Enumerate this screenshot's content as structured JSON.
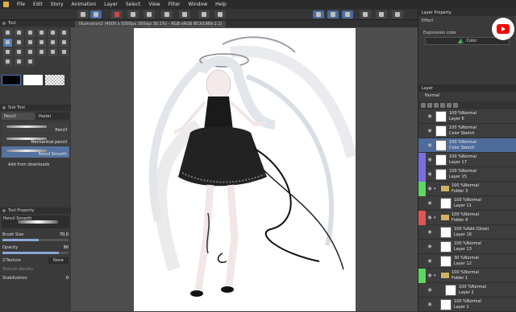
{
  "menu": {
    "items": [
      "File",
      "Edit",
      "Story",
      "Animation",
      "Layer",
      "Select",
      "View",
      "Filter",
      "Window",
      "Help"
    ]
  },
  "toolbar": {
    "buttons": [
      "menu-icon",
      "undo-icon",
      "redo-icon",
      "save-icon",
      "copy-icon",
      "paste-icon",
      "transform-icon",
      "select-all-icon",
      "deselect-icon",
      "pen-stabilize-icon",
      "snap-icon",
      "snap-ruler-icon",
      "ruler-icon",
      "refresh-icon",
      "grid-icon"
    ]
  },
  "tool_panel": {
    "title": "Tool"
  },
  "subtool_panel": {
    "title": "Sub Tool",
    "tabs": [
      "Pencil",
      "Pastel"
    ],
    "brushes": [
      {
        "name": "Pencil"
      },
      {
        "name": "Mechanical pencil"
      },
      {
        "name": "Pencil Smooth"
      }
    ],
    "add_from_downloads": "Add from downloads"
  },
  "tool_property": {
    "title": "Tool Property",
    "preview_label": "Pencil Smooth",
    "brush_size_label": "Brush Size",
    "brush_size_value": "70.0",
    "opacity_label": "Opacity",
    "opacity_value": "90",
    "texture_label": "2-Texture",
    "texture_value": "None",
    "blend_label": "Texture density",
    "stabilization_label": "Stabilization",
    "stabilization_value": "0"
  },
  "document": {
    "tab_title": "Illustration2 (4000 x 5000px 350dpi 30.1%) - RGB sRGB IEC61966-2.1)"
  },
  "layer_property": {
    "title": "Layer Property",
    "effect_label": "Effect",
    "expression_label": "Expression color",
    "expression_value": "Color"
  },
  "layer_panel": {
    "title": "Layer",
    "blend_mode": "Normal",
    "layers": [
      {
        "line1": "100 %Normal",
        "line2": "Layer 6",
        "kind": "layer",
        "indent": 0,
        "color": ""
      },
      {
        "line1": "100 %Normal",
        "line2": "Color Sketch",
        "kind": "layer",
        "indent": 0,
        "color": ""
      },
      {
        "line1": "100 %Normal",
        "line2": "Color Sketch",
        "kind": "layer",
        "indent": 0,
        "color": "",
        "selected": true
      },
      {
        "line1": "100 %Normal",
        "line2": "Layer 17",
        "kind": "layer",
        "indent": 0,
        "color": "#7b6fe0"
      },
      {
        "line1": "100 %Normal",
        "line2": "Layer 15",
        "kind": "layer",
        "indent": 0,
        "color": "#7b6fe0"
      },
      {
        "line1": "100 %Normal",
        "line2": "Folder 3",
        "kind": "folder",
        "indent": 0,
        "color": "#5fd65f"
      },
      {
        "line1": "100 %Normal",
        "line2": "Layer 11",
        "kind": "layer",
        "indent": 1,
        "color": ""
      },
      {
        "line1": "100 %Normal",
        "line2": "Folder 4",
        "kind": "folder",
        "indent": 0,
        "color": "#e05555"
      },
      {
        "line1": "100 %Add (Glow)",
        "line2": "Layer 16",
        "kind": "layer",
        "indent": 1,
        "color": ""
      },
      {
        "line1": "100 %Normal",
        "line2": "Layer 13",
        "kind": "layer",
        "indent": 1,
        "color": ""
      },
      {
        "line1": "30 %Normal",
        "line2": "Layer 12",
        "kind": "layer",
        "indent": 1,
        "color": ""
      },
      {
        "line1": "100 %Normal",
        "line2": "Folder 1",
        "kind": "folder",
        "indent": 0,
        "color": "#5fd65f"
      },
      {
        "line1": "100 %Normal",
        "line2": "Layer 2",
        "kind": "layer",
        "indent": 2,
        "color": ""
      },
      {
        "line1": "100 %Normal",
        "line2": "Layer 1",
        "kind": "layer",
        "indent": 1,
        "color": ""
      }
    ]
  },
  "colors": {
    "accent": "#4a6c9e",
    "selected_layer": "#4f6b9b",
    "youtube_red": "#ff0000"
  }
}
